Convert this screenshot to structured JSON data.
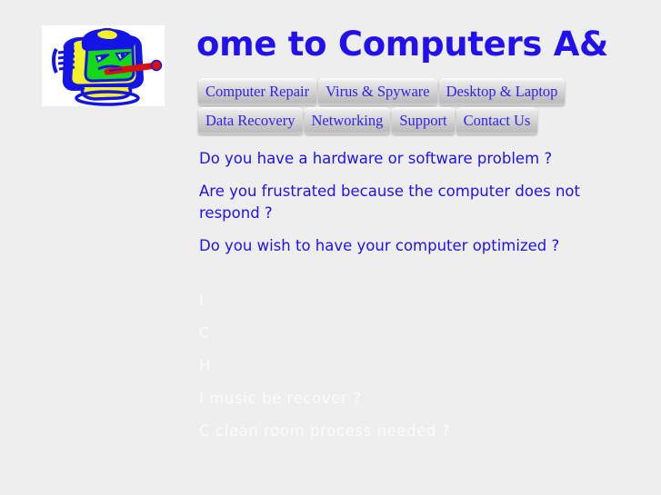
{
  "page": {
    "background_color": "#eeeeee",
    "accent_blue": "#2211ee",
    "faint_text_color": "#fbfbfb"
  },
  "logo": {
    "alt": "sick-computer-logo",
    "description": "cartoon computer monitor with green face and thermometer in mouth",
    "colors": {
      "hair": "#1414e6",
      "face": "#15d819",
      "case": "#f2f22a",
      "thermometer": "#d81010",
      "background": "#ffffff"
    }
  },
  "header": {
    "title": "ome to Computers A&"
  },
  "nav": {
    "rows": [
      {
        "items": [
          {
            "label": "Computer Repair",
            "name": "nav-computer-repair"
          },
          {
            "label": "Virus & Spyware",
            "name": "nav-virus-spyware"
          },
          {
            "label": "Desktop & Laptop",
            "name": "nav-desktop-laptop"
          }
        ]
      },
      {
        "items": [
          {
            "label": "Data Recovery",
            "name": "nav-data-recovery"
          },
          {
            "label": "Networking",
            "name": "nav-networking"
          },
          {
            "label": "Support",
            "name": "nav-support"
          },
          {
            "label": "Contact Us",
            "name": "nav-contact-us"
          }
        ]
      }
    ]
  },
  "main": {
    "questions": [
      " Do you have a hardware or software problem ?",
      " Are you frustrated because the computer does not respond ?",
      " Do you wish to have your computer optimized ?"
    ],
    "faint_lines": [
      "I",
      "C",
      "H",
      "I music be recover ?",
      "C clean room process needed ?"
    ]
  }
}
